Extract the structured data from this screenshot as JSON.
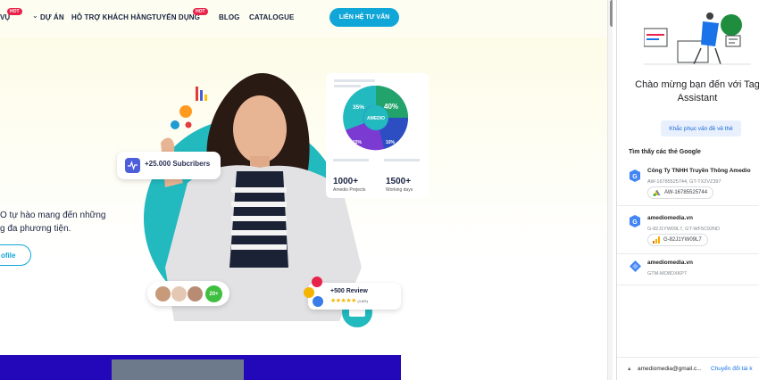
{
  "website": {
    "nav": {
      "item_services_tail": "VỤ",
      "item_projects": "DỰ ÁN",
      "item_support": "HỖ TRỢ KHÁCH HÀNG",
      "item_careers": "TUYỂN DỤNG",
      "item_blog": "BLOG",
      "item_catalogue": "CATALOGUE",
      "hot_badge": "HOT",
      "cta_label": "LIÊN HỆ TƯ VẤN"
    },
    "hero": {
      "line1": "O tự hào mang đến những",
      "line2": "g đa phương tiện.",
      "profile_button": "ofile"
    },
    "art": {
      "subscribers": "+25.000 Subcribers",
      "donut_center": "AMEDIO",
      "donut_pct_left": "35%",
      "donut_pct_right": "40%",
      "donut_pct_bottom_left": "15%",
      "donut_pct_bottom_right": "10%",
      "stat1_value": "1000+",
      "stat1_label": "Amedio Projects",
      "stat2_value": "1500+",
      "stat2_label": "Working days",
      "avatars_more": "20+",
      "review_text": "+500 Review",
      "stars": "★★★★★",
      "review_score": "(4.8/5)"
    },
    "colors": {
      "accent": "#10a6d8",
      "hot": "#e8234a",
      "band": "#2208b8"
    }
  },
  "tag_assistant": {
    "welcome": "Chào mừng bạn đến với Tag Assistant",
    "troubleshoot_button": "Khắc phục vấn đề về thẻ",
    "found_title": "Tìm thấy các thẻ Google",
    "tags": [
      {
        "name": "Công Ty TNHH Truyền Thông Amedio",
        "ids": "AW-16785525744, GT-TX2VZ397",
        "chip": "AW-16785525744",
        "icon": "google-tag-icon",
        "chip_icon": "google-ads-icon"
      },
      {
        "name": "amediomedia.vn",
        "ids": "G-82J1YW09L7, GT-WF5C92ND",
        "chip": "G-82J1YW09L7",
        "icon": "google-tag-icon",
        "chip_icon": "google-analytics-icon"
      },
      {
        "name": "amediomedia.vn",
        "ids": "GTM-MO8DXKP7",
        "icon": "tag-manager-icon"
      }
    ],
    "account": "amediomedia@gmail.c...",
    "switch_account": "Chuyển đổi tài k"
  }
}
